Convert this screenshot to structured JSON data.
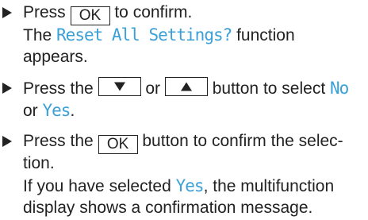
{
  "steps": [
    {
      "line1": {
        "pre": "Press ",
        "key": "OK",
        "post": " to confirm."
      },
      "line2": {
        "pre": "The ",
        "display": "Reset All Settings?",
        "post": " function"
      },
      "line3": {
        "text": "appears."
      }
    },
    {
      "line1": {
        "pre": "Press the ",
        "key_down": "down-arrow-icon",
        "mid": " or ",
        "key_up": "up-arrow-icon",
        "post": " button to select ",
        "display": "No"
      },
      "line2": {
        "pre": "or ",
        "display": "Yes",
        "post": "."
      }
    },
    {
      "line1": {
        "pre": "Press the ",
        "key": "OK",
        "post": " button to confirm the selec-"
      },
      "line2": {
        "text": "tion."
      },
      "line3": {
        "pre": "If you have selected ",
        "display": "Yes",
        "post": ", the multifunction"
      },
      "line4": {
        "text": "display shows a confirmation message."
      }
    }
  ],
  "colors": {
    "text": "#222222",
    "display_text": "#3aa0d8",
    "background": "#ffffff"
  }
}
